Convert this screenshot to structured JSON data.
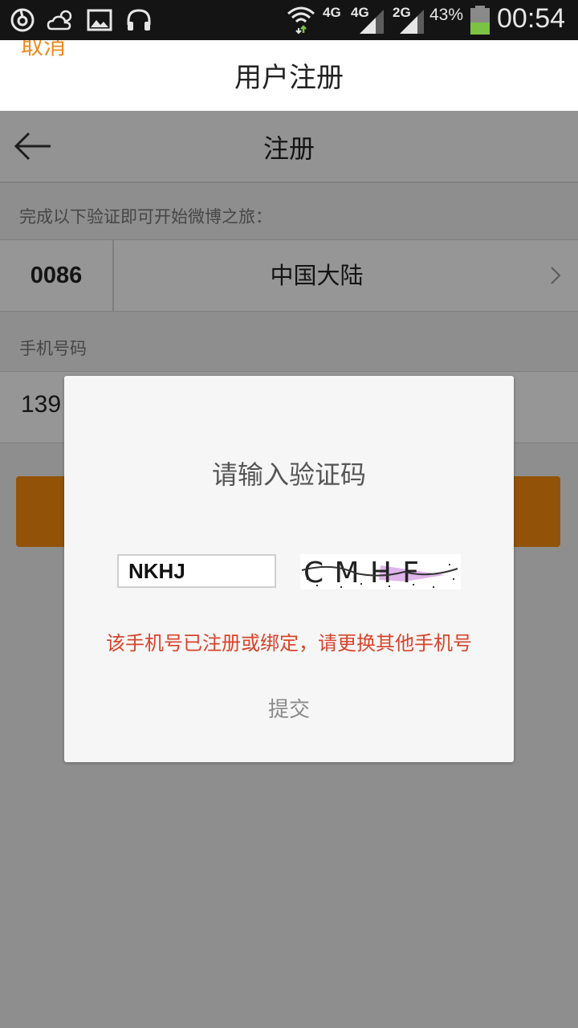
{
  "status_bar": {
    "network_4g_a": "4G",
    "network_4g_b": "4G",
    "network_2g": "2G",
    "battery_percent": "43%",
    "time": "00:54",
    "colors": {
      "background": "#141414",
      "icon": "#e6e6e6",
      "battery_fill": "#7dc242",
      "wifi_arrow": "#7dc242"
    }
  },
  "top_bar": {
    "cancel_label": "取消",
    "title": "用户注册",
    "colors": {
      "cancel": "#f08a1c"
    }
  },
  "register_page": {
    "title": "注册",
    "hint": "完成以下验证即可开始微博之旅：",
    "country_code": "0086",
    "country_name": "中国大陆",
    "phone_label": "手机号码",
    "phone_value": "139",
    "colors": {
      "next_button": "#f88d10"
    }
  },
  "dialog": {
    "title": "请输入验证码",
    "captcha_input_value": "NKHJ",
    "captcha_image_text": "CMHF",
    "error_message": "该手机号已注册或绑定，请更换其他手机号",
    "submit_label": "提交",
    "colors": {
      "error": "#d9442b"
    }
  }
}
